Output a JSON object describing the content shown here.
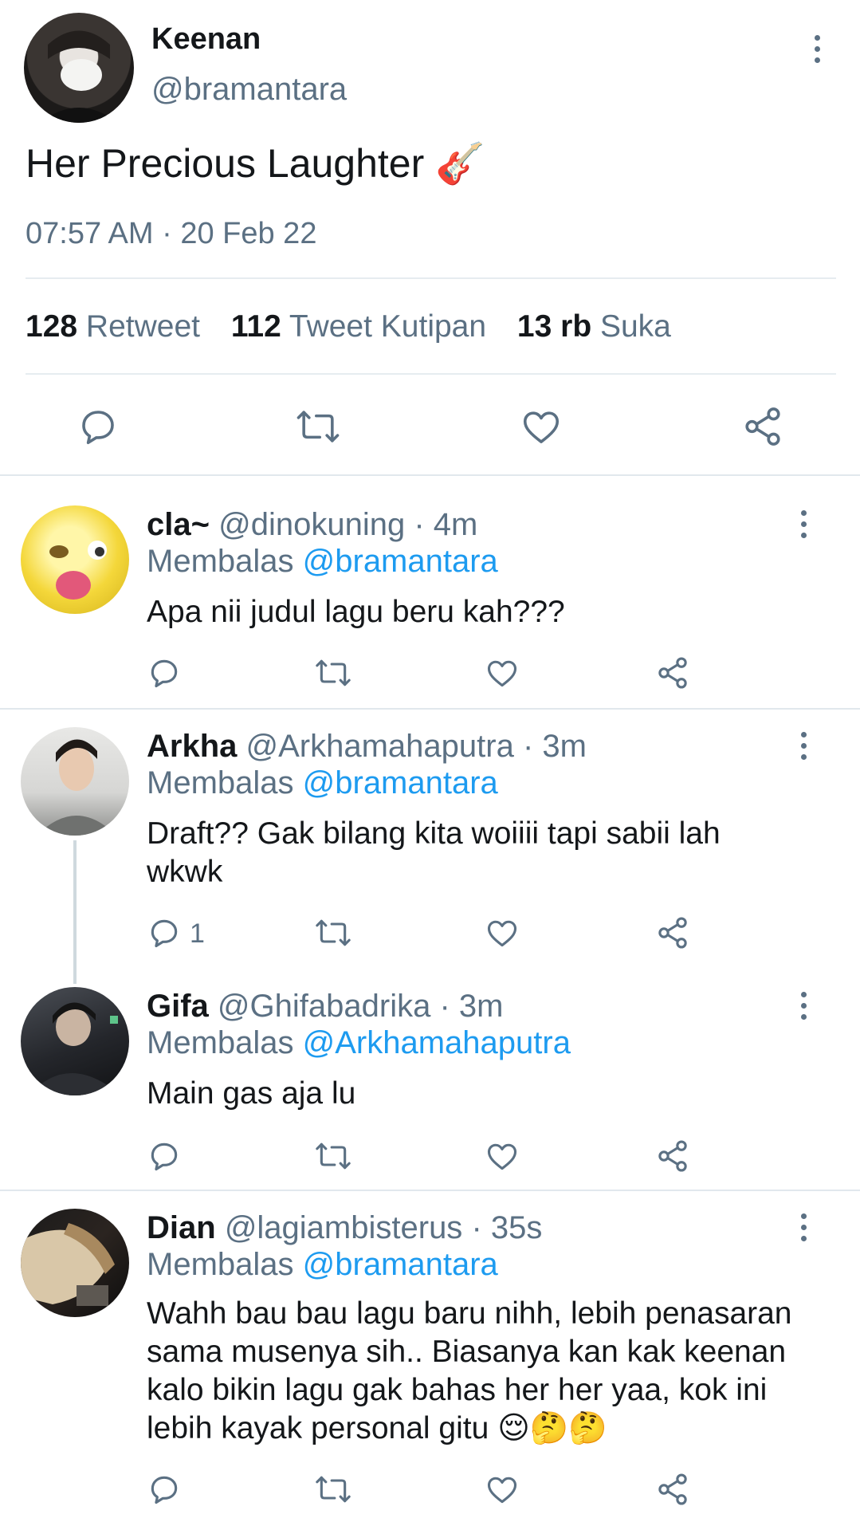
{
  "tweet": {
    "author_name": "Keenan",
    "author_handle": "@bramantara",
    "text": "Her Precious Laughter",
    "emoji": "🎸",
    "timestamp": "07:57 AM · 20 Feb 22",
    "stats": {
      "retweets_value": "128",
      "retweets_label": "Retweet",
      "quotes_value": "112",
      "quotes_label": "Tweet Kutipan",
      "likes_value": "13 rb",
      "likes_label": "Suka"
    }
  },
  "replies": [
    {
      "name": "cla~",
      "handle": "@dinokuning",
      "time": "· 4m",
      "reply_prefix": "Membalas",
      "reply_to": "@bramantara",
      "text": "Apa nii judul lagu beru kah???",
      "reply_count": ""
    },
    {
      "name": "Arkha",
      "handle": "@Arkhamahaputra",
      "time": "· 3m",
      "reply_prefix": "Membalas",
      "reply_to": "@bramantara",
      "text": "Draft?? Gak bilang kita woiiii tapi sabii lah wkwk",
      "reply_count": "1"
    },
    {
      "name": "Gifa",
      "handle": "@Ghifabadrika",
      "time": "· 3m",
      "reply_prefix": "Membalas",
      "reply_to": "@Arkhamahaputra",
      "text": "Main gas aja lu",
      "reply_count": ""
    },
    {
      "name": "Dian",
      "handle": "@lagiambisterus",
      "time": "· 35s",
      "reply_prefix": "Membalas",
      "reply_to": "@bramantara",
      "text": "Wahh bau bau lagu baru nihh, lebih penasaran sama musenya sih.. Biasanya kan kak keenan kalo bikin lagu gak bahas her her yaa, kok ini lebih kayak personal gitu",
      "emoji": "😌🤔🤔",
      "reply_count": ""
    }
  ],
  "colors": {
    "muted": "#5b7083",
    "link": "#1d9bf0",
    "divider": "#e6ecf0"
  }
}
